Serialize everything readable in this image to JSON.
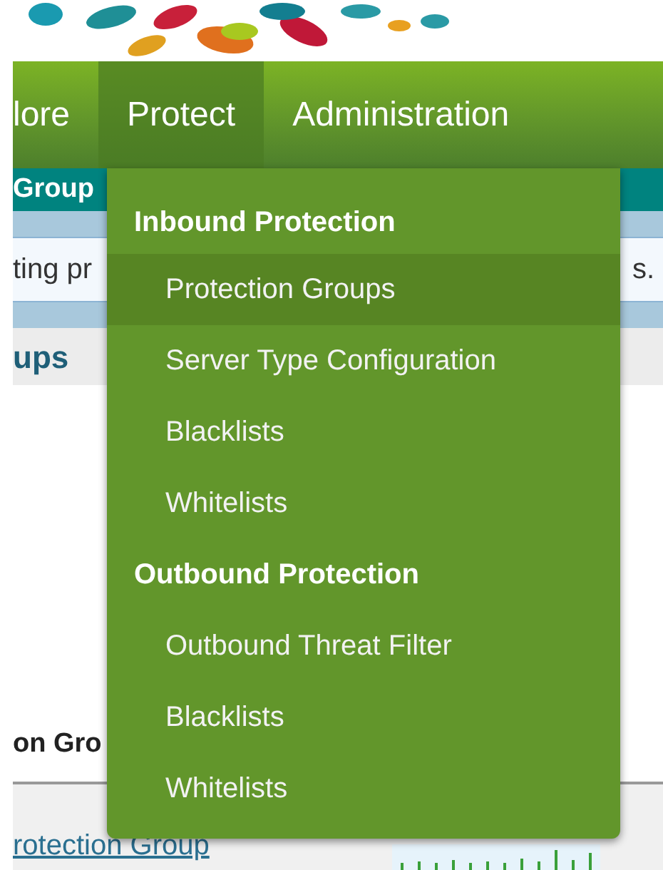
{
  "nav": {
    "items": [
      {
        "label": "lore",
        "selected": false
      },
      {
        "label": "Protect",
        "selected": true
      },
      {
        "label": "Administration",
        "selected": false
      }
    ]
  },
  "subnav": {
    "label": "Group"
  },
  "info": {
    "text_left": "ting pr",
    "text_right": "s."
  },
  "section_title": "ups",
  "table": {
    "column_header": "on Gro",
    "row": {
      "link": "rotection Group"
    }
  },
  "dropdown": {
    "sections": [
      {
        "title": "Inbound Protection",
        "items": [
          {
            "label": "Protection Groups",
            "selected": true
          },
          {
            "label": "Server Type Configuration",
            "selected": false
          },
          {
            "label": "Blacklists",
            "selected": false
          },
          {
            "label": "Whitelists",
            "selected": false
          }
        ]
      },
      {
        "title": "Outbound Protection",
        "items": [
          {
            "label": "Outbound Threat Filter",
            "selected": false
          },
          {
            "label": "Blacklists",
            "selected": false
          },
          {
            "label": "Whitelists",
            "selected": false
          }
        ]
      }
    ]
  }
}
